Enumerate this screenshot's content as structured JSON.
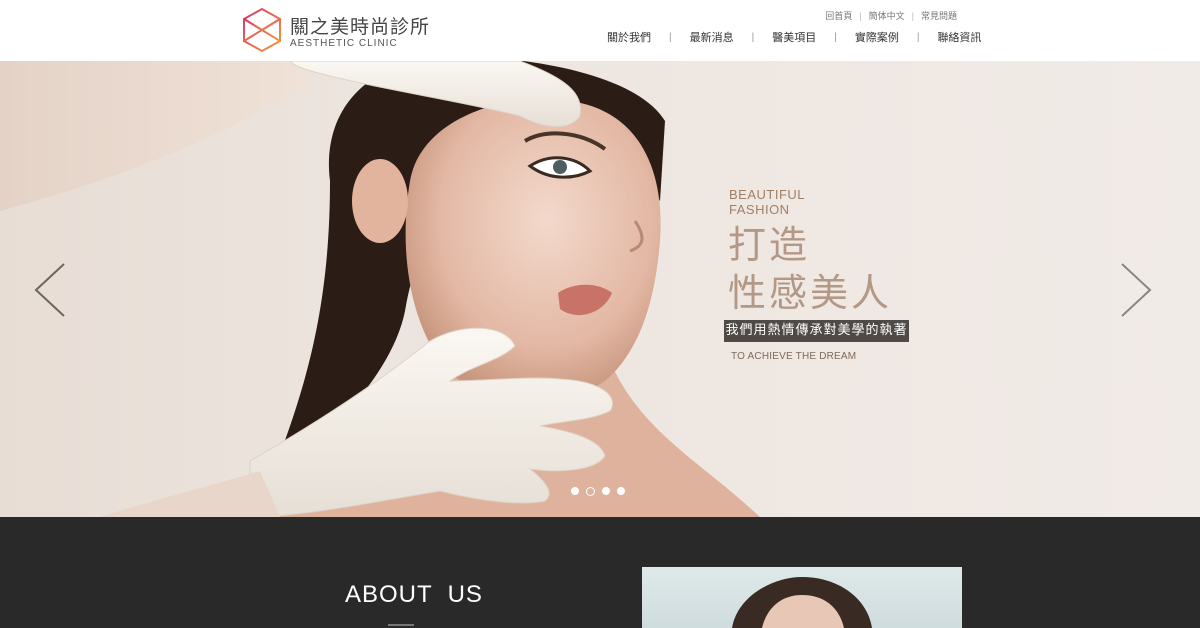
{
  "header": {
    "brand_cn": "關之美時尚診所",
    "brand_en": "AESTHETIC CLINIC",
    "top_links": [
      "回首頁",
      "簡体中文",
      "常見問題"
    ],
    "nav": [
      "關於我們",
      "最新消息",
      "醫美項目",
      "實際案例",
      "聯絡資訊"
    ],
    "nav_separator": "|",
    "top_separator": "|"
  },
  "hero": {
    "tag_line1": "BEAUTIFUL",
    "tag_line2": "FASHION",
    "title_line1": "打造",
    "title_line2": "性感美人",
    "banner": "我們用熱情傳承對美學的執著",
    "subtitle": "TO ACHIEVE THE DREAM",
    "slides_count": 4,
    "active_slide": 2
  },
  "about": {
    "title": "ABOUT  US"
  },
  "colors": {
    "dark_section": "#292929",
    "accent_text": "#b39886",
    "banner_bg": "#4f4a46",
    "logo_pink": "#e0457b",
    "logo_orange": "#f08a3c"
  }
}
